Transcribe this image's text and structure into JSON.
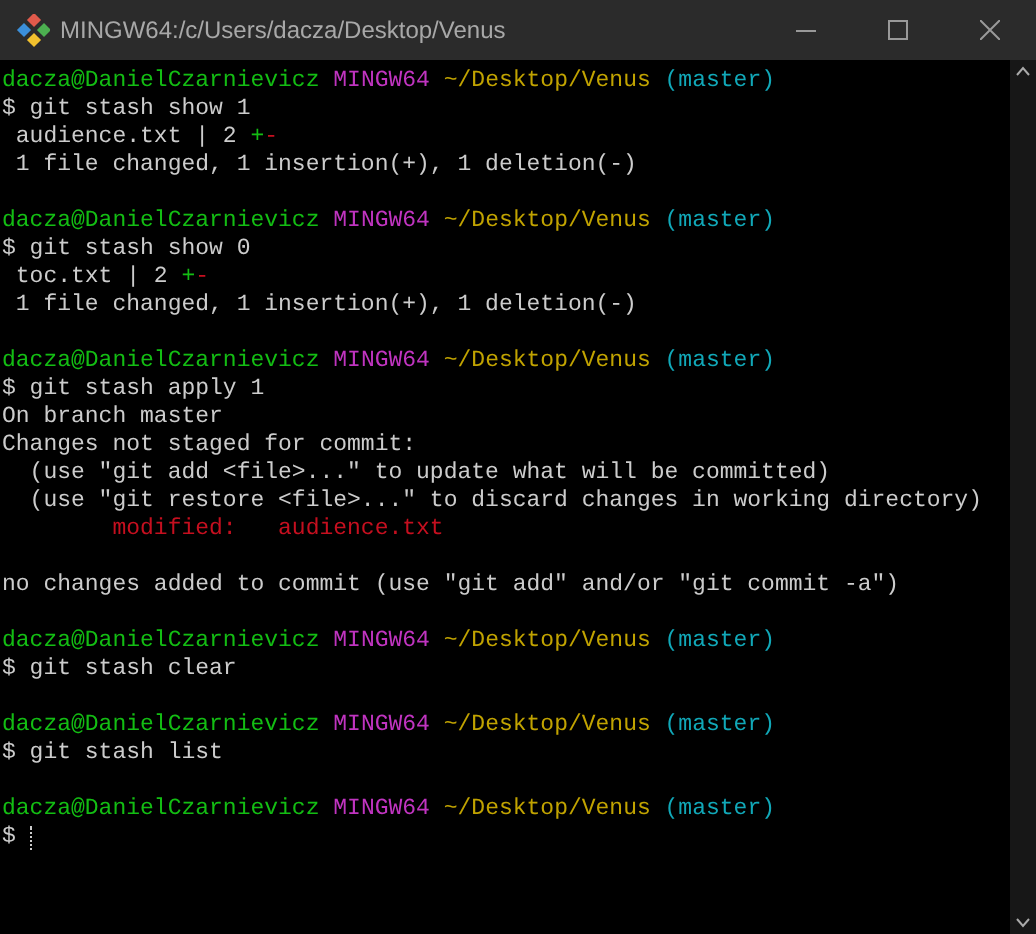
{
  "window": {
    "title": "MINGW64:/c/Users/dacza/Desktop/Venus"
  },
  "lines": [
    {
      "kind": "text",
      "segments": [
        {
          "text": "dacza@DanielCzarnievicz ",
          "color": "#13bd13"
        },
        {
          "text": "MINGW64 ",
          "color": "#c034c0"
        },
        {
          "text": "~/Desktop/Venus ",
          "color": "#c1a300"
        },
        {
          "text": "(master)",
          "color": "#11a8b8"
        }
      ]
    },
    {
      "kind": "text",
      "segments": [
        {
          "text": "$ git stash show 1",
          "color": "#cccccc"
        }
      ]
    },
    {
      "kind": "text",
      "segments": [
        {
          "text": " audience.txt | 2 ",
          "color": "#cccccc"
        },
        {
          "text": "+",
          "color": "#13bd13"
        },
        {
          "text": "-",
          "color": "#c50f1f"
        }
      ]
    },
    {
      "kind": "text",
      "segments": [
        {
          "text": " 1 file changed, 1 insertion(+), 1 deletion(-)",
          "color": "#cccccc"
        }
      ]
    },
    {
      "kind": "blank"
    },
    {
      "kind": "text",
      "segments": [
        {
          "text": "dacza@DanielCzarnievicz ",
          "color": "#13bd13"
        },
        {
          "text": "MINGW64 ",
          "color": "#c034c0"
        },
        {
          "text": "~/Desktop/Venus ",
          "color": "#c1a300"
        },
        {
          "text": "(master)",
          "color": "#11a8b8"
        }
      ]
    },
    {
      "kind": "text",
      "segments": [
        {
          "text": "$ git stash show 0",
          "color": "#cccccc"
        }
      ]
    },
    {
      "kind": "text",
      "segments": [
        {
          "text": " toc.txt | 2 ",
          "color": "#cccccc"
        },
        {
          "text": "+",
          "color": "#13bd13"
        },
        {
          "text": "-",
          "color": "#c50f1f"
        }
      ]
    },
    {
      "kind": "text",
      "segments": [
        {
          "text": " 1 file changed, 1 insertion(+), 1 deletion(-)",
          "color": "#cccccc"
        }
      ]
    },
    {
      "kind": "blank"
    },
    {
      "kind": "text",
      "segments": [
        {
          "text": "dacza@DanielCzarnievicz ",
          "color": "#13bd13"
        },
        {
          "text": "MINGW64 ",
          "color": "#c034c0"
        },
        {
          "text": "~/Desktop/Venus ",
          "color": "#c1a300"
        },
        {
          "text": "(master)",
          "color": "#11a8b8"
        }
      ]
    },
    {
      "kind": "text",
      "segments": [
        {
          "text": "$ git stash apply 1",
          "color": "#cccccc"
        }
      ]
    },
    {
      "kind": "text",
      "segments": [
        {
          "text": "On branch master",
          "color": "#cccccc"
        }
      ]
    },
    {
      "kind": "text",
      "segments": [
        {
          "text": "Changes not staged for commit:",
          "color": "#cccccc"
        }
      ]
    },
    {
      "kind": "text",
      "segments": [
        {
          "text": "  (use \"git add <file>...\" to update what will be committed)",
          "color": "#cccccc"
        }
      ]
    },
    {
      "kind": "text",
      "segments": [
        {
          "text": "  (use \"git restore <file>...\" to discard changes in working directory)",
          "color": "#cccccc"
        }
      ]
    },
    {
      "kind": "text",
      "segments": [
        {
          "text": "        modified:   audience.txt",
          "color": "#c50f1f"
        }
      ]
    },
    {
      "kind": "blank"
    },
    {
      "kind": "text",
      "segments": [
        {
          "text": "no changes added to commit (use \"git add\" and/or \"git commit -a\")",
          "color": "#cccccc"
        }
      ]
    },
    {
      "kind": "blank"
    },
    {
      "kind": "text",
      "segments": [
        {
          "text": "dacza@DanielCzarnievicz ",
          "color": "#13bd13"
        },
        {
          "text": "MINGW64 ",
          "color": "#c034c0"
        },
        {
          "text": "~/Desktop/Venus ",
          "color": "#c1a300"
        },
        {
          "text": "(master)",
          "color": "#11a8b8"
        }
      ]
    },
    {
      "kind": "text",
      "segments": [
        {
          "text": "$ git stash clear",
          "color": "#cccccc"
        }
      ]
    },
    {
      "kind": "blank"
    },
    {
      "kind": "text",
      "segments": [
        {
          "text": "dacza@DanielCzarnievicz ",
          "color": "#13bd13"
        },
        {
          "text": "MINGW64 ",
          "color": "#c034c0"
        },
        {
          "text": "~/Desktop/Venus ",
          "color": "#c1a300"
        },
        {
          "text": "(master)",
          "color": "#11a8b8"
        }
      ]
    },
    {
      "kind": "text",
      "segments": [
        {
          "text": "$ git stash list",
          "color": "#cccccc"
        }
      ]
    },
    {
      "kind": "blank"
    },
    {
      "kind": "text",
      "segments": [
        {
          "text": "dacza@DanielCzarnievicz ",
          "color": "#13bd13"
        },
        {
          "text": "MINGW64 ",
          "color": "#c034c0"
        },
        {
          "text": "~/Desktop/Venus ",
          "color": "#c1a300"
        },
        {
          "text": "(master)",
          "color": "#11a8b8"
        }
      ]
    },
    {
      "kind": "text",
      "cursor": true,
      "segments": [
        {
          "text": "$",
          "color": "#cccccc"
        }
      ]
    }
  ]
}
